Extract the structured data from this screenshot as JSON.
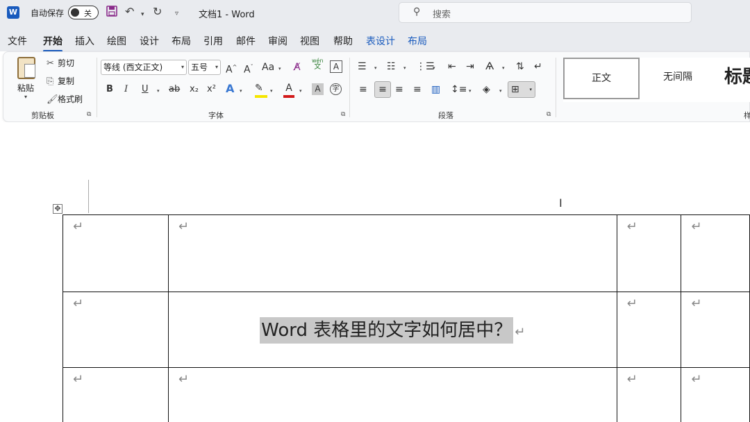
{
  "titlebar": {
    "app_icon": "W",
    "autosave_label": "自动保存",
    "autosave_state": "关",
    "doc_title": "文档1 - Word",
    "search_placeholder": "搜索",
    "icons": [
      "save-icon",
      "undo-icon",
      "redo-icon",
      "customize-qat-icon",
      "search-icon"
    ]
  },
  "tabs": [
    "文件",
    "开始",
    "插入",
    "绘图",
    "设计",
    "布局",
    "引用",
    "邮件",
    "审阅",
    "视图",
    "帮助",
    "表设计",
    "布局"
  ],
  "active_tab": "开始",
  "ribbon": {
    "clipboard": {
      "paste": "粘贴",
      "cut": "剪切",
      "copy": "复制",
      "format_painter": "格式刷",
      "group_label": "剪贴板"
    },
    "font": {
      "font_name": "等线 (西文正文)",
      "font_size": "五号",
      "grow": "A^",
      "shrink": "Aˇ",
      "change_case": "Aa",
      "phonetic_top": "wén",
      "phonetic_bottom": "文",
      "bold": "B",
      "italic": "I",
      "underline": "U",
      "strike": "ab",
      "subscript": "x₂",
      "superscript": "x²",
      "group_label": "字体",
      "colors": {
        "highlight": "#f5e600",
        "font_color": "#d21a1a",
        "text_effects": "#3a78d2"
      }
    },
    "paragraph": {
      "group_label": "段落"
    },
    "styles": {
      "items": [
        "正文",
        "无间隔",
        "标题"
      ],
      "group_label_partial": "样"
    }
  },
  "document": {
    "cell_mark": "↵",
    "selected_text": "Word 表格里的文字如何居中？",
    "selection_color": "#c8c8c8"
  }
}
